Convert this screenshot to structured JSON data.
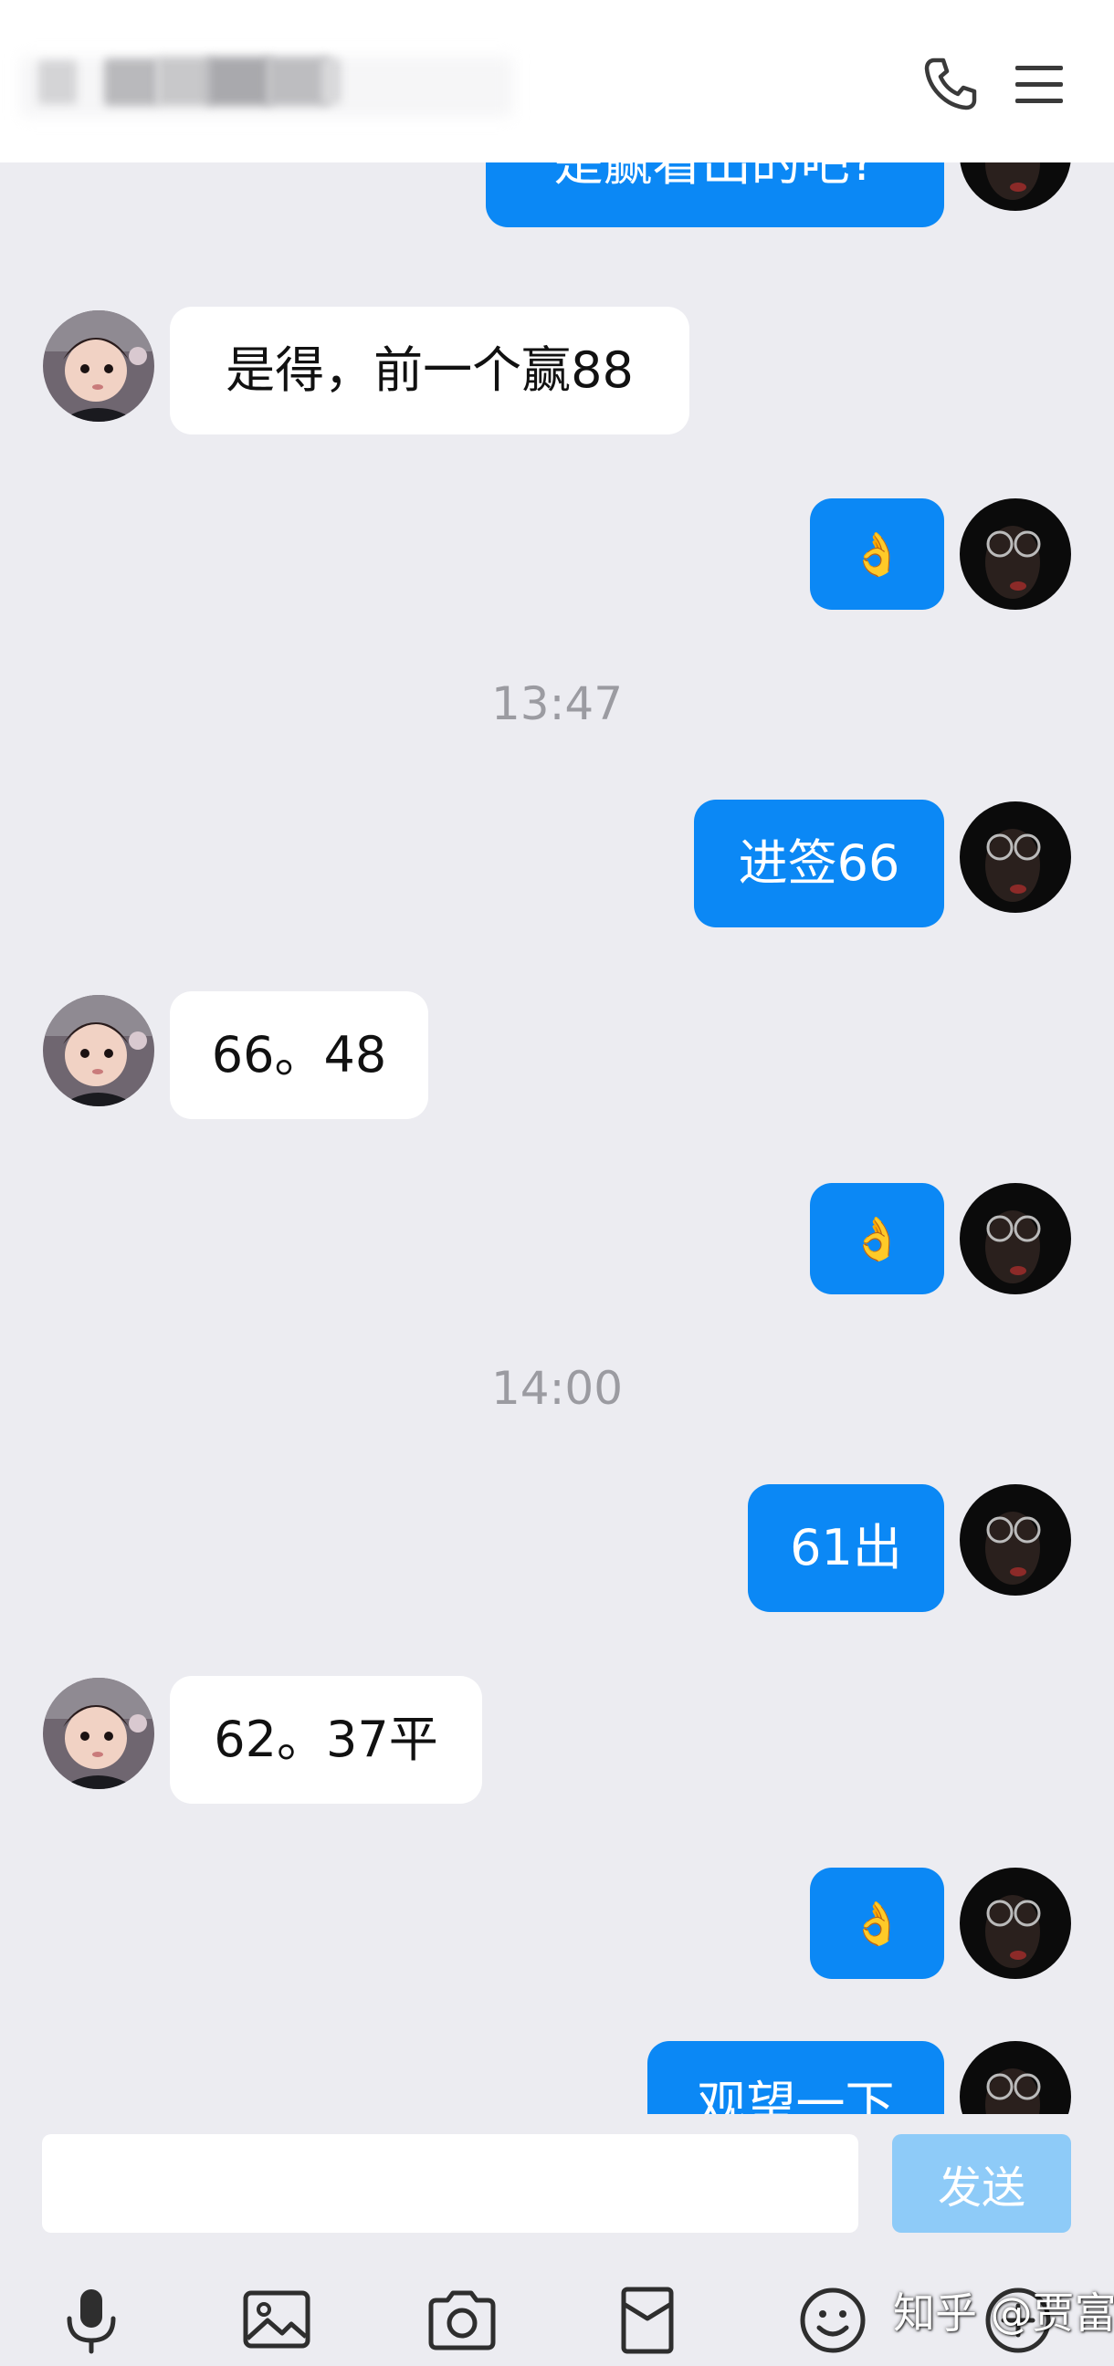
{
  "header": {
    "phone_icon": "phone-icon",
    "menu_icon": "hamburger-menu-icon"
  },
  "colors": {
    "outgoing_bubble": "#0b88f5",
    "incoming_bubble": "#ffffff",
    "background": "#ececf1",
    "send_button": "#8ecbf8",
    "timestamp": "#9b9ba1"
  },
  "messages": [
    {
      "type": "msg",
      "side": "out",
      "avatar": "self-avatar",
      "text": "是赢看出的吧?"
    },
    {
      "type": "msg",
      "side": "in",
      "avatar": "child-avatar",
      "text": "是得，前一个赢88"
    },
    {
      "type": "msg",
      "side": "out",
      "avatar": "self-avatar",
      "text": "👌"
    },
    {
      "type": "time",
      "text": "13:47"
    },
    {
      "type": "msg",
      "side": "out",
      "avatar": "self-avatar",
      "text": "进签66"
    },
    {
      "type": "msg",
      "side": "in",
      "avatar": "child-avatar",
      "text": "66。48"
    },
    {
      "type": "msg",
      "side": "out",
      "avatar": "self-avatar",
      "text": "👌"
    },
    {
      "type": "time",
      "text": "14:00"
    },
    {
      "type": "msg",
      "side": "out",
      "avatar": "self-avatar",
      "text": "61出"
    },
    {
      "type": "msg",
      "side": "in",
      "avatar": "child-avatar",
      "text": "62。37平"
    },
    {
      "type": "msg",
      "side": "out",
      "avatar": "self-avatar",
      "text": "👌"
    },
    {
      "type": "msg",
      "side": "out",
      "avatar": "self-avatar",
      "text": "观望一下"
    }
  ],
  "composer": {
    "input_value": "",
    "send_label": "发送"
  },
  "toolbar": {
    "icons": [
      "microphone-icon",
      "image-icon",
      "camera-icon",
      "red-packet-icon",
      "emoji-icon",
      "add-icon"
    ]
  },
  "watermark": "知乎 @贾富贵"
}
